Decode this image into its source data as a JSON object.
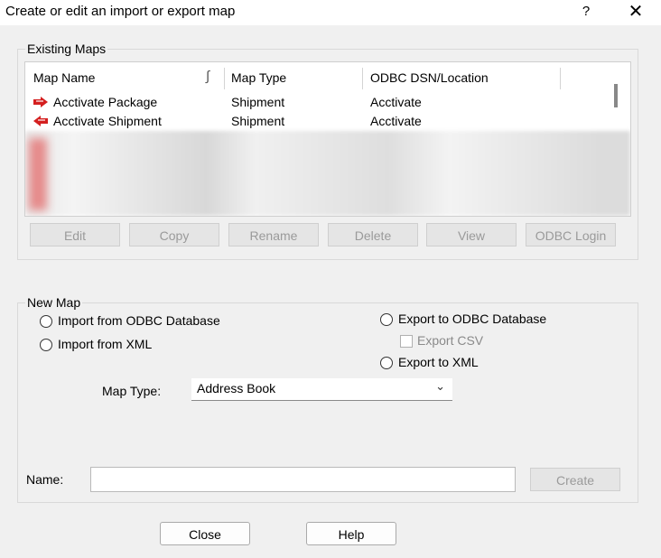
{
  "dialog": {
    "title": "Create or edit an import or export map",
    "help": "?",
    "close": "✕"
  },
  "existing": {
    "legend": "Existing Maps",
    "columns": [
      "Map Name",
      "Map Type",
      "ODBC DSN/Location"
    ],
    "rows": [
      {
        "name": "Acctivate Package",
        "type": "Shipment",
        "location": "Acctivate"
      },
      {
        "name": "Acctivate Shipment",
        "type": "Shipment",
        "location": "Acctivate"
      }
    ],
    "buttons": [
      "Edit",
      "Copy",
      "Rename",
      "Delete",
      "View",
      "ODBC Login"
    ]
  },
  "newmap": {
    "legend": "New Map",
    "import_odbc": "Import from ODBC Database",
    "import_xml": "Import from XML",
    "export_odbc": "Export to ODBC Database",
    "export_csv": "Export CSV",
    "export_xml": "Export to XML",
    "map_type_label": "Map Type:",
    "map_type_value": "Address Book",
    "name_label": "Name:",
    "name_value": "",
    "create": "Create"
  },
  "footer": {
    "close": "Close",
    "help": "Help"
  },
  "icons": {
    "row_icon": "red-arrow-icon",
    "sort_icon": "sort-indicator-icon",
    "dropdown": "chevron-down-icon"
  },
  "colors": {
    "row_icon": "#d41f1f"
  }
}
